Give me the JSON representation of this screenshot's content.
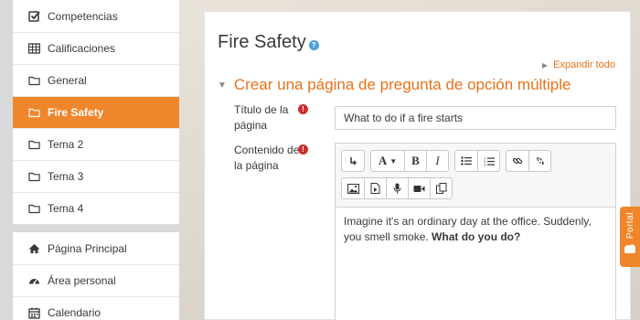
{
  "sidebar": {
    "course_items": [
      {
        "label": "Competencias",
        "icon": "checkbox-icon"
      },
      {
        "label": "Calificaciones",
        "icon": "table-icon"
      },
      {
        "label": "General",
        "icon": "folder-icon"
      },
      {
        "label": "Fire Safety",
        "icon": "folder-icon",
        "active": true
      },
      {
        "label": "Tema 2",
        "icon": "folder-icon"
      },
      {
        "label": "Tema 3",
        "icon": "folder-icon"
      },
      {
        "label": "Tema 4",
        "icon": "folder-icon"
      }
    ],
    "site_items": [
      {
        "label": "Página Principal",
        "icon": "home-icon"
      },
      {
        "label": "Área personal",
        "icon": "dashboard-icon"
      },
      {
        "label": "Calendario",
        "icon": "calendar-icon"
      }
    ]
  },
  "main": {
    "page_title": "Fire Safety",
    "help_glyph": "?",
    "expand_all": "Expandir todo",
    "section_title": "Crear una página de pregunta de opción múltiple",
    "fields": {
      "title_label": "Título de la página",
      "title_value": "What to do if a fire starts",
      "content_label": "Contenido de la página",
      "required_glyph": "!"
    },
    "editor": {
      "toolbar": {
        "font_label": "A",
        "bold_label": "B",
        "italic_label": "I"
      },
      "content_text": "Imagine it's an ordinary day at the office. Suddenly, you smell smoke. ",
      "content_bold": "What do you do?"
    }
  },
  "portal_tab": {
    "label": "Portal"
  },
  "colors": {
    "accent": "#f0862b",
    "link": "#e8711a",
    "required": "#c9302c",
    "help": "#4a9fd9"
  }
}
